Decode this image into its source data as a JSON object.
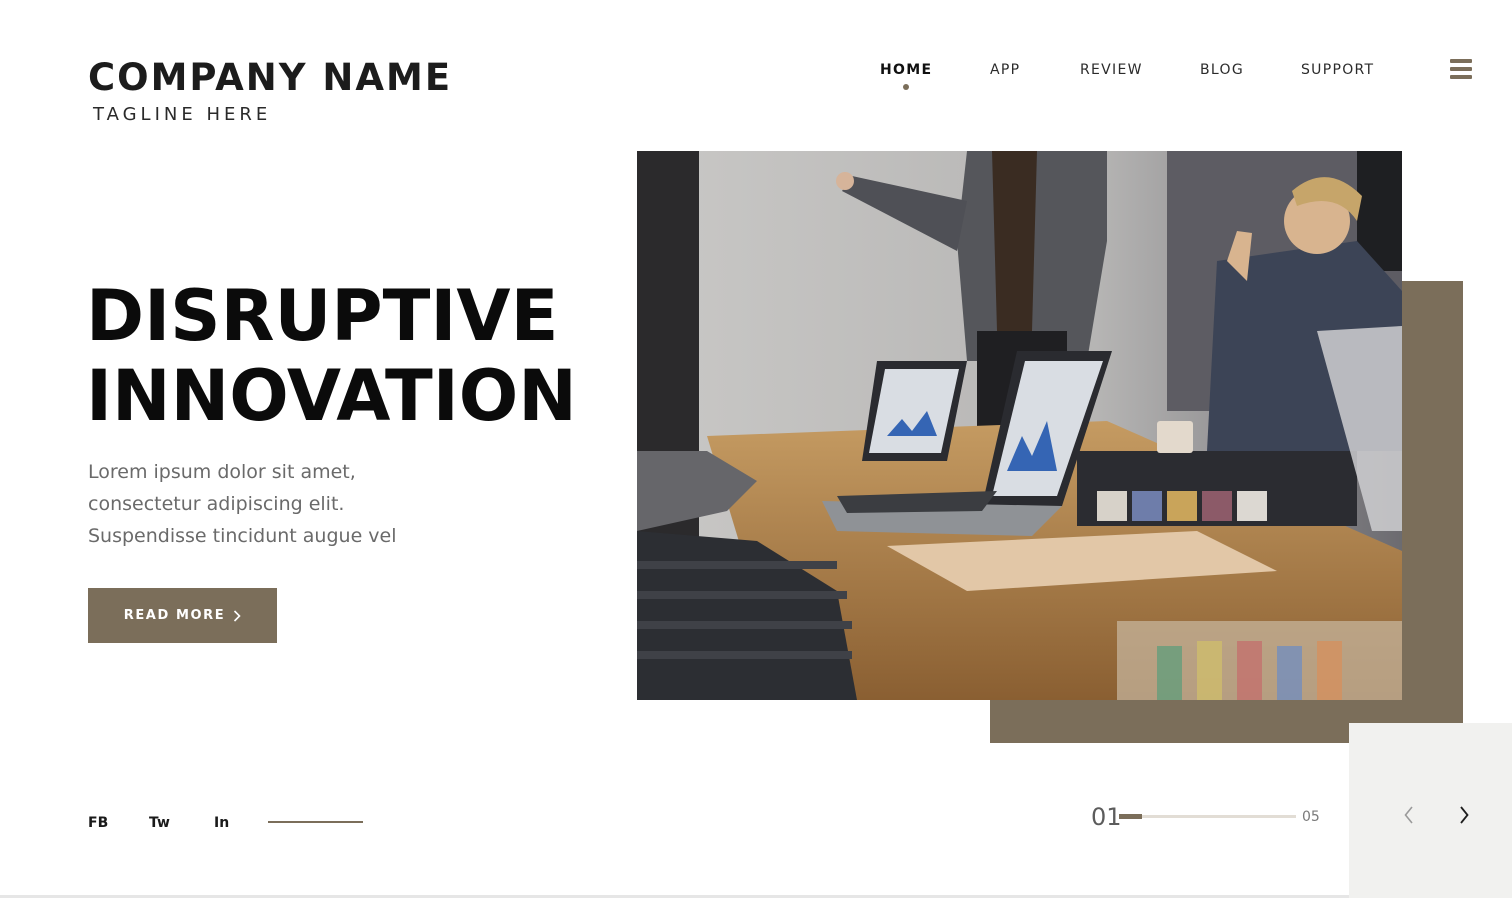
{
  "brand": {
    "name": "COMPANY NAME",
    "tagline": "TAGLINE HERE"
  },
  "nav": {
    "items": [
      {
        "label": "HOME",
        "active": true
      },
      {
        "label": "APP",
        "active": false
      },
      {
        "label": "REVIEW",
        "active": false
      },
      {
        "label": "BLOG",
        "active": false
      },
      {
        "label": "SUPPORT",
        "active": false
      }
    ],
    "menu_icon": "hamburger-menu-icon"
  },
  "hero": {
    "title_line1": "DISRUPTIVE",
    "title_line2": "INNOVATION",
    "text_line1": "Lorem ipsum dolor sit amet,",
    "text_line2": "consectetur adipiscing elit.",
    "text_line3": "Suspendisse tincidunt augue vel",
    "button_label": "READ MORE",
    "button_icon": "chevron-right-icon"
  },
  "social": {
    "fb": "FB",
    "tw": "Tw",
    "in": "In"
  },
  "slider": {
    "current": "01",
    "total": "05",
    "progress": 0.2,
    "prev_icon": "chevron-left-icon",
    "next_icon": "chevron-right-icon"
  },
  "colors": {
    "accent": "#7b6e5a",
    "panel": "#f1f1ef",
    "text_dark": "#0b0b0b",
    "text_muted": "#6a6a6a"
  }
}
